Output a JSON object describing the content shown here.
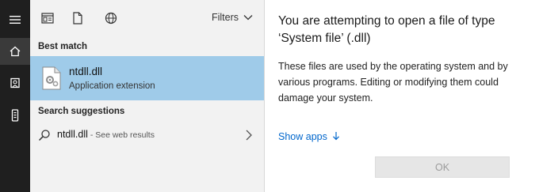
{
  "rail": {
    "items": [
      {
        "icon": "hamburger-menu-icon"
      },
      {
        "icon": "home-icon",
        "active": true
      },
      {
        "icon": "documents-icon"
      },
      {
        "icon": "device-icon"
      }
    ]
  },
  "search": {
    "top_icons": [
      "app-window-icon",
      "document-icon",
      "globe-icon"
    ],
    "filters_label": "Filters",
    "best_match_label": "Best match",
    "best_match": {
      "title": "ntdll.dll",
      "subtitle": "Application extension",
      "icon": "dll-file-icon"
    },
    "suggestions_label": "Search suggestions",
    "suggestion": {
      "main": "ntdll.dll",
      "sub": " - See web results"
    }
  },
  "dialog": {
    "title": "You are attempting to open a file of type ‘System file’ (.dll)",
    "body": "These files are used by the operating system and by various programs. Editing or modifying them could damage your system.",
    "show_apps_label": "Show apps",
    "ok_label": "OK"
  },
  "colors": {
    "rail_bg": "#1f1f1f",
    "panel_bg": "#f2f2f2",
    "selection_bg": "#9fcbe9",
    "link": "#0066cc"
  }
}
